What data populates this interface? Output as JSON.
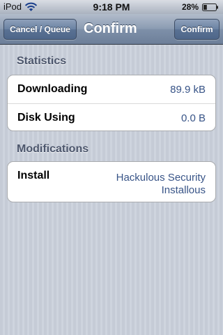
{
  "status_bar": {
    "carrier": "iPod",
    "time": "9:18 PM",
    "battery_percent": "28%",
    "icons": [
      "wifi-icon",
      "battery-icon"
    ]
  },
  "nav_bar": {
    "left_button": "Cancel / Queue",
    "title": "Confirm",
    "right_button": "Confirm"
  },
  "statistics": {
    "header": "Statistics",
    "rows": [
      {
        "label": "Downloading",
        "value": "89.9 kB"
      },
      {
        "label": "Disk Using",
        "value": "0.0 B"
      }
    ]
  },
  "modifications": {
    "header": "Modifications",
    "rows": [
      {
        "label": "Install",
        "value": "Hackulous Security Installous"
      }
    ]
  },
  "colors": {
    "nav_bar": "#7e90a9",
    "value_text": "#385487",
    "section_header": "#4c566c",
    "background": "#c7cdd8"
  }
}
